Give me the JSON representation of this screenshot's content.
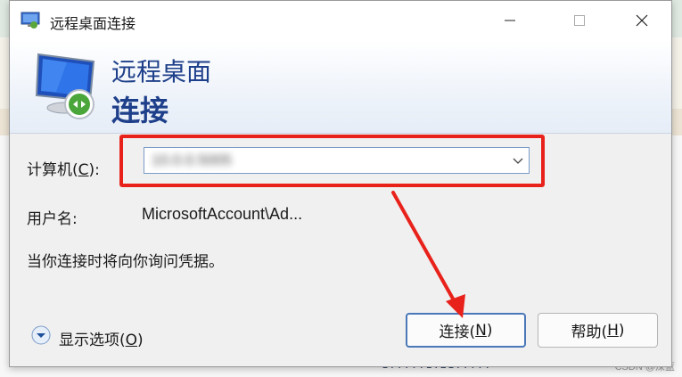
{
  "window": {
    "title": "远程桌面连接",
    "controls": {
      "minimize_icon": "minimize-icon",
      "maximize_icon": "maximize-icon",
      "close_icon": "close-icon"
    }
  },
  "banner": {
    "line1": "远程桌面",
    "line2": "连接",
    "icon": "remote-desktop-monitor-icon"
  },
  "form": {
    "computer_label_prefix": "计算机(",
    "computer_label_key": "C",
    "computer_label_suffix": "):",
    "computer_value": "10.0.0.5005",
    "user_label": "用户名:",
    "user_value": "MicrosoftAccount\\Ad...",
    "info_text": "当你连接时将向你询问凭据。"
  },
  "footer": {
    "options_prefix": "显示选项(",
    "options_key": "O",
    "options_suffix": ")",
    "connect_prefix": "连接(",
    "connect_key": "N",
    "connect_suffix": ")",
    "help_prefix": "帮助(",
    "help_key": "H",
    "help_suffix": ")"
  },
  "background": {
    "bottom_text": "1.....1.21.....",
    "watermark": "CSDN @深蓝"
  },
  "colors": {
    "accent": "#1e3f8a",
    "highlight": "#e8221b",
    "button_border": "#4a78b8"
  }
}
